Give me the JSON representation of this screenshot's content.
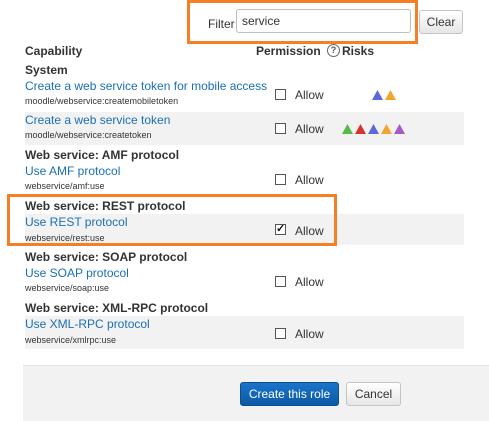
{
  "filter": {
    "label": "Filter",
    "value": "service",
    "clear_label": "Clear"
  },
  "table": {
    "headers": {
      "capability": "Capability",
      "permission": "Permission",
      "help_glyph": "?",
      "risks": "Risks"
    },
    "sections": [
      {
        "title": "System",
        "rows": [
          {
            "link": "Create a web service token for mobile access",
            "code": "moodle/webservice:createmobiletoken",
            "allow": "Allow",
            "checked": false,
            "risks": [
              "#5b6ad6",
              "#f2a62b"
            ]
          },
          {
            "link": "Create a web service token",
            "code": "moodle/webservice:createtoken",
            "allow": "Allow",
            "checked": false,
            "risks": [
              "#57b947",
              "#d9322e",
              "#5b6ad6",
              "#f2a62b",
              "#a659c9"
            ]
          }
        ]
      },
      {
        "title": "Web service: AMF protocol",
        "rows": [
          {
            "link": "Use AMF protocol",
            "code": "webservice/amf:use",
            "allow": "Allow",
            "checked": false,
            "risks": []
          }
        ]
      },
      {
        "title": "Web service: REST protocol",
        "rows": [
          {
            "link": "Use REST protocol",
            "code": "webservice/rest:use",
            "allow": "Allow",
            "checked": true,
            "risks": []
          }
        ]
      },
      {
        "title": "Web service: SOAP protocol",
        "rows": [
          {
            "link": "Use SOAP protocol",
            "code": "webservice/soap:use",
            "allow": "Allow",
            "checked": false,
            "risks": []
          }
        ]
      },
      {
        "title": "Web service: XML-RPC protocol",
        "rows": [
          {
            "link": "Use XML-RPC protocol",
            "code": "webservice/xmlrpc:use",
            "allow": "Allow",
            "checked": false,
            "risks": []
          }
        ]
      }
    ]
  },
  "actions": {
    "create_label": "Create this role",
    "cancel_label": "Cancel"
  },
  "colors": {
    "highlight": "#f47f27",
    "link": "#1a6fb5",
    "primary": "#0c5aa6"
  }
}
